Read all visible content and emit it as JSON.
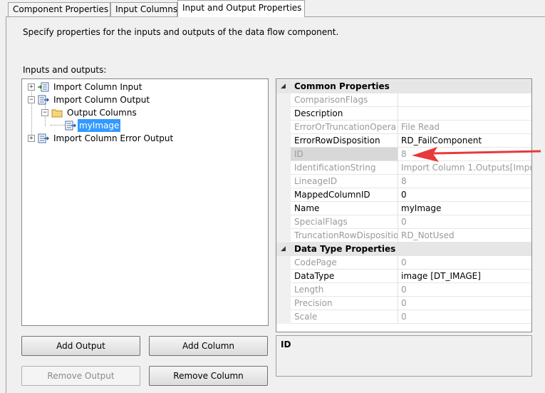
{
  "tabs": [
    {
      "label": "Component Properties"
    },
    {
      "label": "Input Columns"
    },
    {
      "label": "Input and Output Properties"
    }
  ],
  "description": "Specify properties for the inputs and outputs of the data flow component.",
  "io_label": "Inputs and outputs:",
  "tree": {
    "import_input": "Import Column Input",
    "import_output": "Import Column Output",
    "output_columns": "Output Columns",
    "my_image": "myImage",
    "error_output": "Import Column Error Output"
  },
  "grid": {
    "common": "Common Properties",
    "datatype_cat": "Data Type Properties",
    "rows": [
      {
        "name": "ComparisonFlags",
        "value": ""
      },
      {
        "name": "Description",
        "value": ""
      },
      {
        "name": "ErrorOrTruncationOpera",
        "value": "File Read"
      },
      {
        "name": "ErrorRowDisposition",
        "value": "RD_FailComponent"
      },
      {
        "name": "ID",
        "value": "8"
      },
      {
        "name": "IdentificationString",
        "value": "Import Column 1.Outputs[Impo"
      },
      {
        "name": "LineageID",
        "value": "8"
      },
      {
        "name": "MappedColumnID",
        "value": "0"
      },
      {
        "name": "Name",
        "value": "myImage"
      },
      {
        "name": "SpecialFlags",
        "value": "0"
      },
      {
        "name": "TruncationRowDispositio",
        "value": "RD_NotUsed"
      }
    ],
    "dt_rows": [
      {
        "name": "CodePage",
        "value": "0"
      },
      {
        "name": "DataType",
        "value": "image [DT_IMAGE]"
      },
      {
        "name": "Length",
        "value": "0"
      },
      {
        "name": "Precision",
        "value": "0"
      },
      {
        "name": "Scale",
        "value": "0"
      }
    ]
  },
  "desc_title": "ID",
  "buttons": {
    "add_output": "Add Output",
    "add_column": "Add Column",
    "remove_output": "Remove Output",
    "remove_column": "Remove Column"
  },
  "colors": {
    "selection": "#3399ff",
    "annotation_arrow": "#e8393c"
  }
}
